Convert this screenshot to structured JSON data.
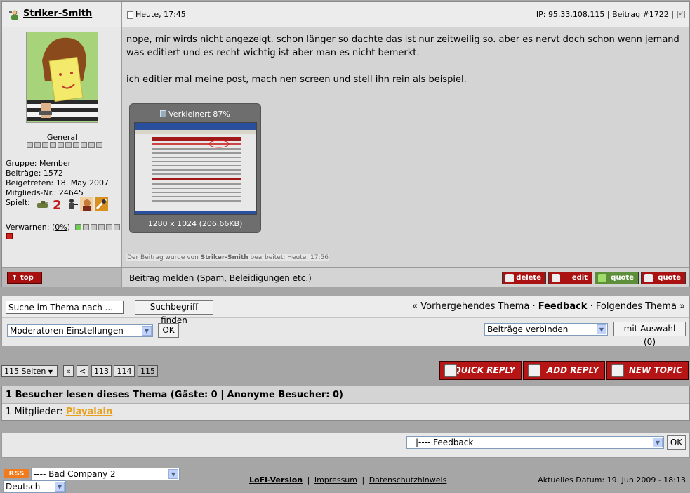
{
  "post": {
    "username": "Striker-Smith",
    "date": "Heute, 17:45",
    "ip_label": "IP:",
    "ip": "95.33.108.115",
    "post_label": "Beitrag",
    "post_number": "#1722",
    "rank": "General",
    "group": "Gruppe: Member",
    "posts": "Beiträge: 1572",
    "joined": "Beigetreten: 18. May 2007",
    "member_no": "Mitglieds-Nr.: 24645",
    "plays": "Spielt:",
    "warn_label": "Verwarnen: (",
    "warn_value": "0%",
    "warn_close": ")",
    "text_1": "nope, mir wirds nicht angezeigt. schon länger so dachte das ist nur zeitweilig so. aber es nervt doch schon wenn jemand was editiert und es recht wichtig ist aber man es nicht bemerkt.",
    "text_2": "ich editier mal meine post, mach nen screen und stell ihn rein als beispiel.",
    "thumb_caption": "Verkleinert 87%",
    "thumb_size": "1280 x 1024 (206.66KB)",
    "edited_prefix": "Der Beitrag wurde von ",
    "edited_user": "Striker-Smith",
    "edited_suffix": " bearbeitet: Heute, 17:56",
    "top_label": "top",
    "report_label": "Beitrag melden (Spam, Beleidigungen etc.)",
    "delete_label": "delete",
    "edit_label": "edit",
    "multiquote_label": "quote",
    "quote_label": "quote"
  },
  "tools": {
    "search_value": "Suche im Thema nach ...",
    "search_button": "Suchbegriff finden",
    "prev_topic": "« Vorhergehendes Thema",
    "sep": "·",
    "forum": "Feedback",
    "next_topic": "Folgendes Thema »",
    "mod_select": "Moderatoren Einstellungen",
    "ok": "OK",
    "merge_select": "Beiträge verbinden",
    "with_selection": "mit Auswahl (0)"
  },
  "pagination": {
    "pages_label": "115 Seiten",
    "first": "«",
    "prev": "<",
    "pages": [
      "113",
      "114",
      "115"
    ],
    "current": "115"
  },
  "actions": {
    "quick_reply": "QUICK REPLY",
    "add_reply": "ADD REPLY",
    "new_topic": "NEW TOPIC"
  },
  "visitors": {
    "header": "1 Besucher lesen dieses Thema (Gäste: 0 | Anonyme Besucher: 0)",
    "members_label": "1 Mitglieder: ",
    "member": "Playalain"
  },
  "jump": {
    "forum_select": "|---- Feedback",
    "ok": "OK"
  },
  "footer": {
    "rss": "RSS",
    "forum_select": "---- Bad Company 2",
    "language": "Deutsch",
    "lofi": "LoFi-Version",
    "impressum": "Impressum",
    "privacy": "Datenschutzhinweis",
    "sep": "|",
    "date": "Aktuelles Datum: 19. Jun 2009 - 18:13"
  }
}
